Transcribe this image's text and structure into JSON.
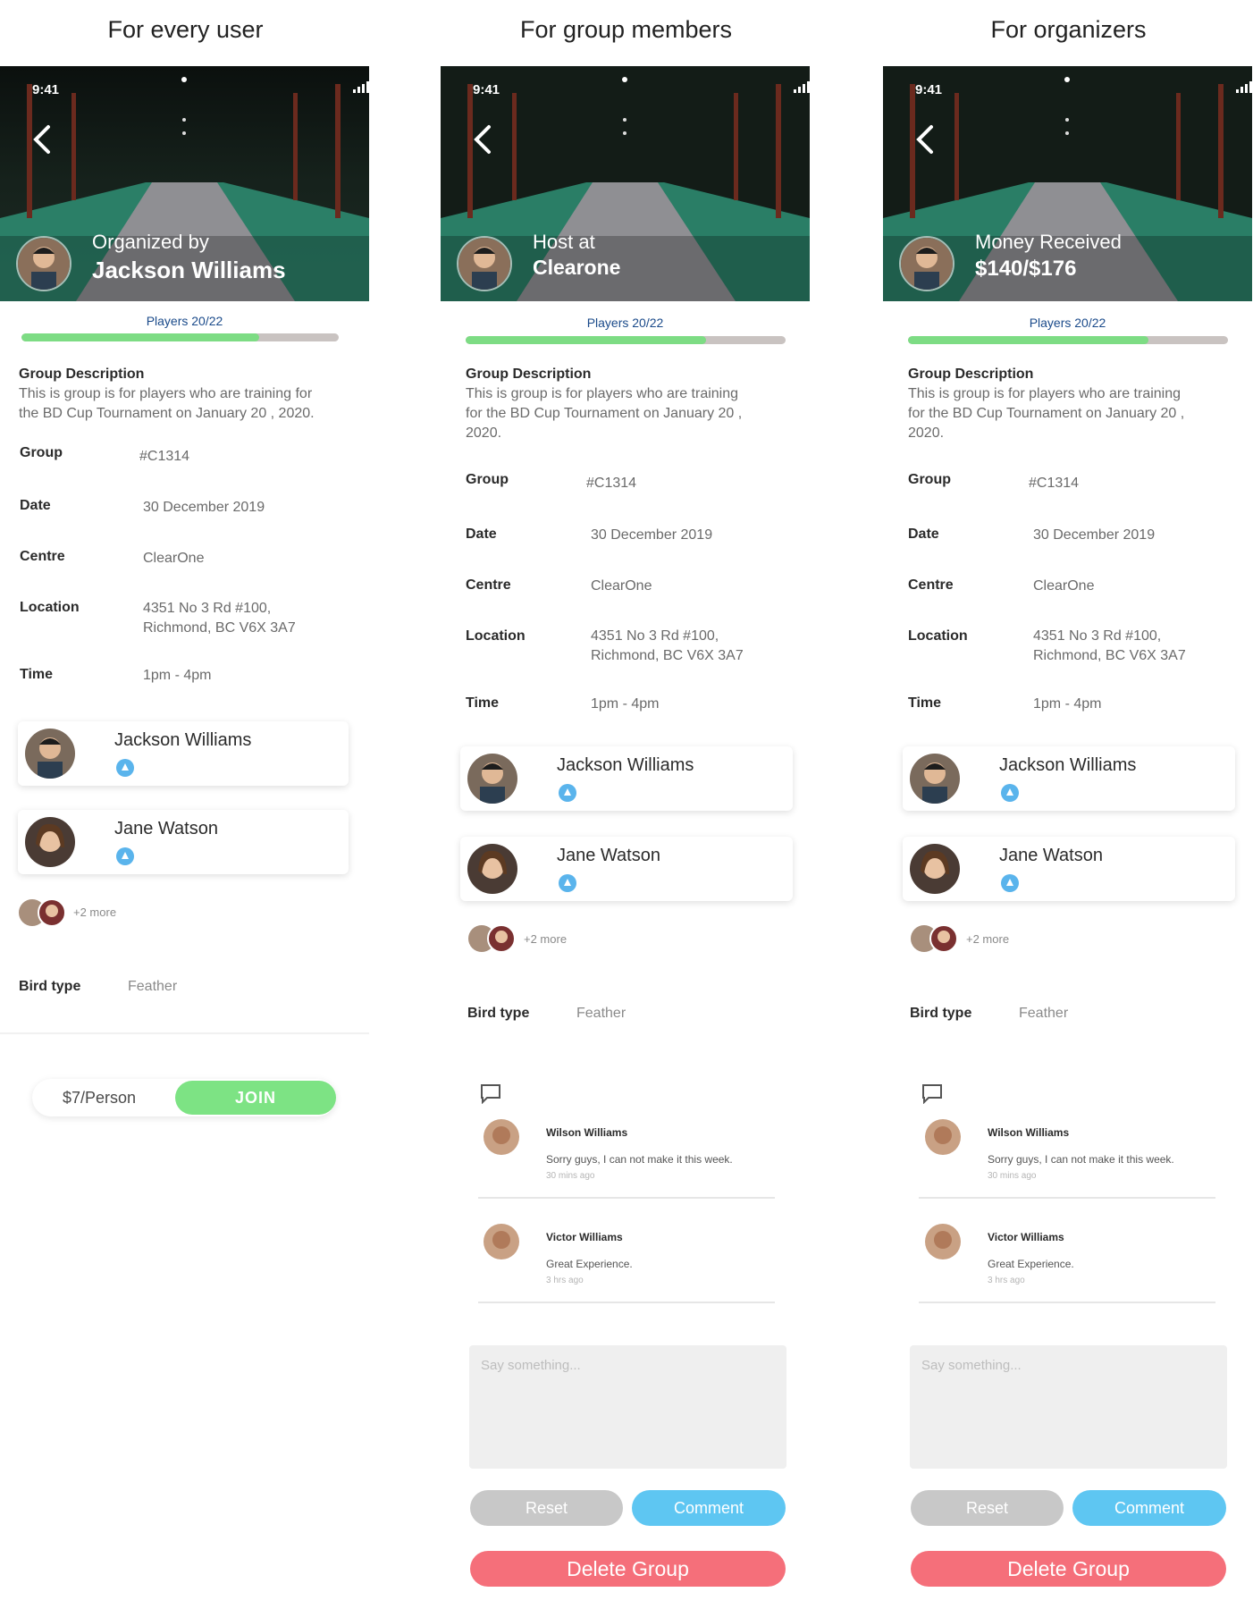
{
  "panels": [
    {
      "title": "For every user",
      "status_time": "9:41",
      "hero_line1": "Organized by",
      "hero_line2": "Jackson Williams",
      "players_label": "Players 20/22",
      "players_progress": 0.75,
      "description_title": "Group Description",
      "description_lines": [
        "This is group is for players who are training for",
        "the BD Cup Tournament on January 20 , 2020."
      ],
      "rows": [
        {
          "label": "Group",
          "value": "#C1314"
        },
        {
          "label": "Date",
          "value": "30 December 2019"
        },
        {
          "label": "Centre",
          "value": "ClearOne"
        },
        {
          "label": "Location",
          "value": "4351 No 3 Rd #100,",
          "value2": "Richmond, BC V6X 3A7"
        },
        {
          "label": "Time",
          "value": "1pm - 4pm"
        }
      ],
      "members": [
        {
          "name": "Jackson Williams"
        },
        {
          "name": "Jane Watson"
        }
      ],
      "more_text": "+2 more",
      "bird_label": "Bird type",
      "bird_value": "Feather",
      "price": "$7/Person",
      "join": "JOIN"
    },
    {
      "title": "For group members",
      "status_time": "9:41",
      "hero_line1": "Host at",
      "hero_line2": "Clearone",
      "players_label": "Players 20/22",
      "players_progress": 0.75,
      "description_title": "Group Description",
      "description_lines": [
        "This is group is for players who are training",
        "for the BD Cup Tournament on January 20 ,",
        "2020."
      ],
      "rows": [
        {
          "label": "Group",
          "value": "#C1314"
        },
        {
          "label": "Date",
          "value": "30 December 2019"
        },
        {
          "label": "Centre",
          "value": "ClearOne"
        },
        {
          "label": "Location",
          "value": "4351 No 3 Rd #100,",
          "value2": "Richmond, BC V6X 3A7"
        },
        {
          "label": "Time",
          "value": "1pm - 4pm"
        }
      ],
      "members": [
        {
          "name": "Jackson Williams"
        },
        {
          "name": "Jane Watson"
        }
      ],
      "more_text": "+2 more",
      "bird_label": "Bird type",
      "bird_value": "Feather",
      "comments": [
        {
          "name": "Wilson Williams",
          "text": "Sorry guys, I can not make it this week.",
          "time": "30 mins ago"
        },
        {
          "name": "Victor Williams",
          "text": "Great Experience.",
          "time": "3 hrs ago"
        }
      ],
      "say_placeholder": "Say something...",
      "reset": "Reset",
      "comment": "Comment",
      "delete": "Delete Group"
    },
    {
      "title": "For organizers",
      "status_time": "9:41",
      "hero_line1": "Money Received",
      "hero_line2": "$140/$176",
      "players_label": "Players 20/22",
      "players_progress": 0.75,
      "description_title": "Group Description",
      "description_lines": [
        "This is group is for players who are training",
        "for the BD Cup Tournament on January 20 ,",
        "2020."
      ],
      "rows": [
        {
          "label": "Group",
          "value": "#C1314"
        },
        {
          "label": "Date",
          "value": "30 December 2019"
        },
        {
          "label": "Centre",
          "value": "ClearOne"
        },
        {
          "label": "Location",
          "value": "4351 No 3 Rd #100,",
          "value2": "Richmond, BC V6X 3A7"
        },
        {
          "label": "Time",
          "value": "1pm - 4pm"
        }
      ],
      "members": [
        {
          "name": "Jackson Williams"
        },
        {
          "name": "Jane Watson"
        }
      ],
      "more_text": "+2 more",
      "bird_label": "Bird type",
      "bird_value": "Feather",
      "comments": [
        {
          "name": "Wilson Williams",
          "text": "Sorry guys, I can not make it this week.",
          "time": "30 mins ago"
        },
        {
          "name": "Victor Williams",
          "text": "Great Experience.",
          "time": "3 hrs ago"
        }
      ],
      "say_placeholder": "Say something...",
      "reset": "Reset",
      "comment": "Comment",
      "delete": "Delete Group"
    }
  ],
  "colors": {
    "progress_fill": "#7ddc84",
    "progress_track": "#c9c3c1",
    "join": "#7de384",
    "comment_button": "#5ec6f2",
    "reset_button": "#c8c8c8",
    "delete_button": "#f56f7a",
    "badge": "#5ab4ec"
  },
  "icons": [
    "back-arrow-icon",
    "signal-icon",
    "wifi-icon",
    "battery-icon",
    "shuttlecock-badge-icon",
    "chat-bubble-icon"
  ]
}
